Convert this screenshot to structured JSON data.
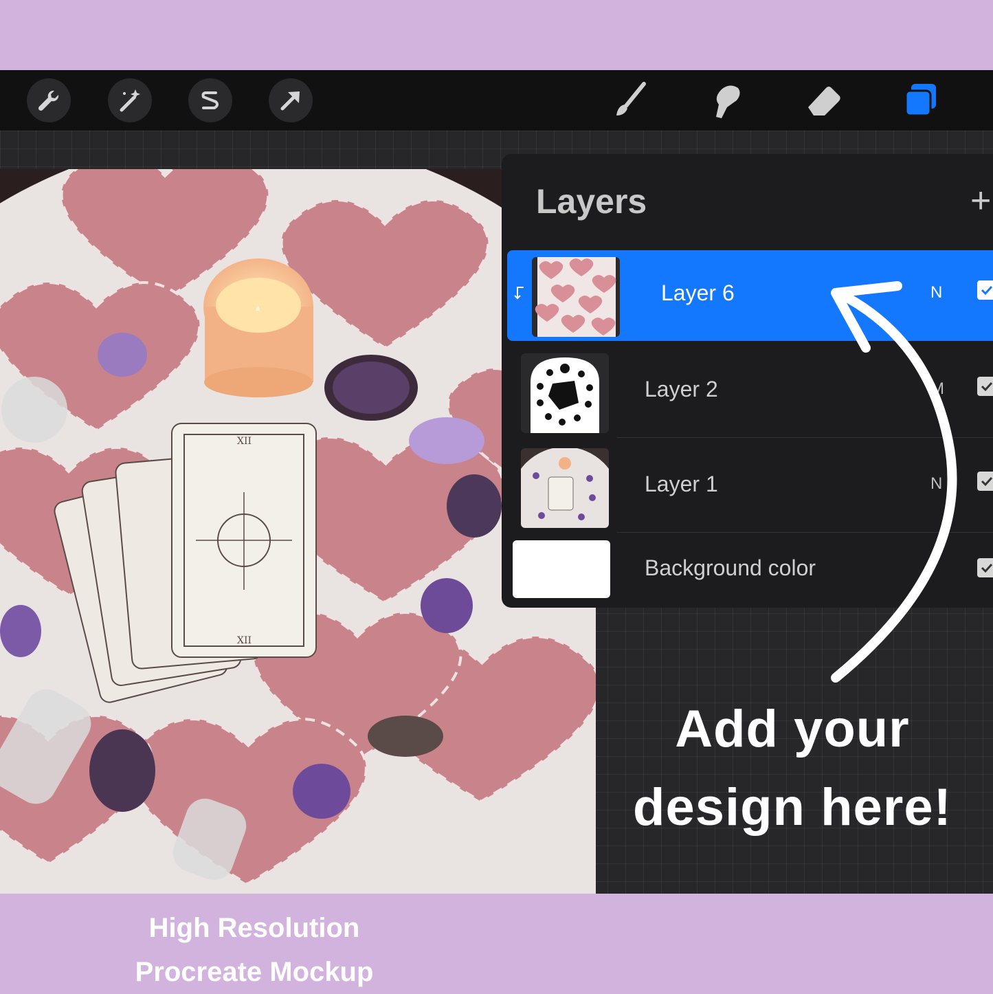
{
  "toolbar": {
    "left_tools": [
      "wrench-icon",
      "magic-wand-icon",
      "selection-s-icon",
      "transform-arrow-icon"
    ],
    "right_tools": [
      "brush-icon",
      "smudge-icon",
      "eraser-icon",
      "layers-icon"
    ],
    "active_color": "#1478ff"
  },
  "layers_panel": {
    "title": "Layers",
    "add_symbol": "+",
    "layers": [
      {
        "name": "Layer 6",
        "mode": "N",
        "selected": true
      },
      {
        "name": "Layer 2",
        "mode": "M",
        "selected": false
      },
      {
        "name": "Layer 1",
        "mode": "N",
        "selected": false
      },
      {
        "name": "Background color",
        "mode": "",
        "selected": false
      }
    ]
  },
  "callout": {
    "line1": "Add your",
    "line2": "design here!"
  },
  "caption": {
    "line1": "High Resolution",
    "line2": "Procreate Mockup"
  },
  "colors": {
    "frame": "#d1b3de",
    "app_bg": "#232325",
    "selection": "#1478ff",
    "heart": "#c9848b"
  }
}
